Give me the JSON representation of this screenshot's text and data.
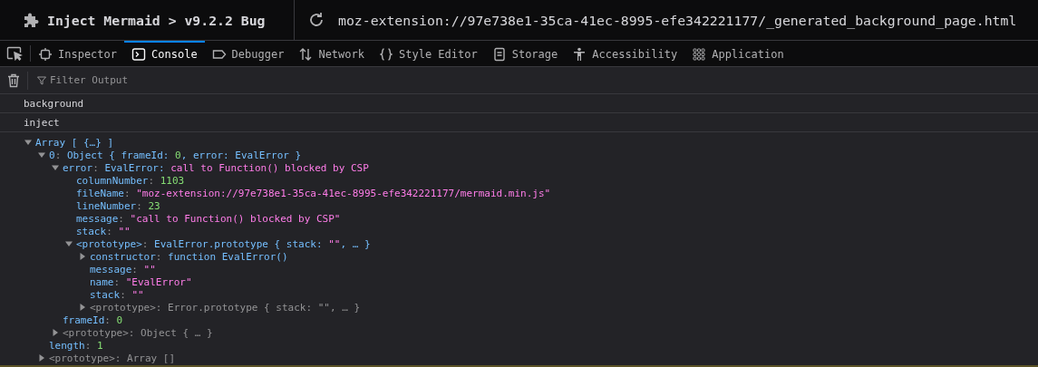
{
  "window": {
    "title": "Inject Mermaid > v9.2.2 Bug",
    "url": "moz-extension://97e738e1-35ca-41ec-8995-efe342221177/_generated_background_page.html"
  },
  "tabs": [
    {
      "label": "Inspector",
      "kind": "chip",
      "selected": false
    },
    {
      "label": "Console",
      "kind": "console",
      "selected": true
    },
    {
      "label": "Debugger",
      "kind": "tag",
      "selected": false
    },
    {
      "label": "Network",
      "kind": "arrows",
      "selected": false
    },
    {
      "label": "Style Editor",
      "kind": "braces",
      "selected": false
    },
    {
      "label": "Storage",
      "kind": "document",
      "selected": false
    },
    {
      "label": "Accessibility",
      "kind": "figure",
      "selected": false
    },
    {
      "label": "Application",
      "kind": "grid",
      "selected": false
    }
  ],
  "filter": {
    "placeholder": "Filter Output"
  },
  "messages": [
    "background",
    "inject"
  ],
  "tree": [
    {
      "expanded": true,
      "parts": [
        {
          "kind": "type",
          "text": "Array [ {…} ]"
        }
      ],
      "children": [
        {
          "expanded": true,
          "parts": [
            {
              "kind": "key",
              "text": "0"
            },
            {
              "kind": "punct",
              "text": ": "
            },
            {
              "kind": "type",
              "text": "Object { frameId: "
            },
            {
              "kind": "number",
              "text": "0"
            },
            {
              "kind": "type",
              "text": ", error: EvalError }"
            }
          ],
          "children": [
            {
              "expanded": true,
              "parts": [
                {
                  "kind": "key",
                  "text": "error"
                },
                {
                  "kind": "punct",
                  "text": ": "
                },
                {
                  "kind": "type",
                  "text": "EvalError: "
                },
                {
                  "kind": "string",
                  "text": "call to Function() blocked by CSP"
                }
              ],
              "children": [
                {
                  "parts": [
                    {
                      "kind": "key",
                      "text": "columnNumber"
                    },
                    {
                      "kind": "punct",
                      "text": ": "
                    },
                    {
                      "kind": "number",
                      "text": "1103"
                    }
                  ]
                },
                {
                  "parts": [
                    {
                      "kind": "key",
                      "text": "fileName"
                    },
                    {
                      "kind": "punct",
                      "text": ": "
                    },
                    {
                      "kind": "string",
                      "text": "\"moz-extension://97e738e1-35ca-41ec-8995-efe342221177/mermaid.min.js\""
                    }
                  ]
                },
                {
                  "parts": [
                    {
                      "kind": "key",
                      "text": "lineNumber"
                    },
                    {
                      "kind": "punct",
                      "text": ": "
                    },
                    {
                      "kind": "number",
                      "text": "23"
                    }
                  ]
                },
                {
                  "parts": [
                    {
                      "kind": "key",
                      "text": "message"
                    },
                    {
                      "kind": "punct",
                      "text": ": "
                    },
                    {
                      "kind": "string",
                      "text": "\"call to Function() blocked by CSP\""
                    }
                  ]
                },
                {
                  "parts": [
                    {
                      "kind": "key",
                      "text": "stack"
                    },
                    {
                      "kind": "punct",
                      "text": ": "
                    },
                    {
                      "kind": "string",
                      "text": "\"\""
                    }
                  ]
                },
                {
                  "expanded": true,
                  "parts": [
                    {
                      "kind": "key",
                      "text": "<prototype>"
                    },
                    {
                      "kind": "punct",
                      "text": ": "
                    },
                    {
                      "kind": "type",
                      "text": "EvalError.prototype { stack: "
                    },
                    {
                      "kind": "string",
                      "text": "\"\""
                    },
                    {
                      "kind": "type",
                      "text": ", … }"
                    }
                  ],
                  "children": [
                    {
                      "expanded": false,
                      "parts": [
                        {
                          "kind": "key",
                          "text": "constructor"
                        },
                        {
                          "kind": "punct",
                          "text": ": "
                        },
                        {
                          "kind": "type",
                          "text": "function EvalError()"
                        }
                      ]
                    },
                    {
                      "parts": [
                        {
                          "kind": "key",
                          "text": "message"
                        },
                        {
                          "kind": "punct",
                          "text": ": "
                        },
                        {
                          "kind": "string",
                          "text": "\"\""
                        }
                      ]
                    },
                    {
                      "parts": [
                        {
                          "kind": "key",
                          "text": "name"
                        },
                        {
                          "kind": "punct",
                          "text": ": "
                        },
                        {
                          "kind": "string",
                          "text": "\"EvalError\""
                        }
                      ]
                    },
                    {
                      "parts": [
                        {
                          "kind": "key",
                          "text": "stack"
                        },
                        {
                          "kind": "punct",
                          "text": ": "
                        },
                        {
                          "kind": "string",
                          "text": "\"\""
                        }
                      ]
                    },
                    {
                      "expanded": false,
                      "parts": [
                        {
                          "kind": "dim",
                          "text": "<prototype>: Error.prototype { stack: \"\", … }"
                        }
                      ]
                    }
                  ]
                }
              ]
            },
            {
              "parts": [
                {
                  "kind": "key",
                  "text": "frameId"
                },
                {
                  "kind": "punct",
                  "text": ": "
                },
                {
                  "kind": "number",
                  "text": "0"
                }
              ]
            },
            {
              "expanded": false,
              "parts": [
                {
                  "kind": "dim",
                  "text": "<prototype>: Object { … }"
                }
              ]
            }
          ]
        },
        {
          "parts": [
            {
              "kind": "key",
              "text": "length"
            },
            {
              "kind": "punct",
              "text": ": "
            },
            {
              "kind": "number",
              "text": "1"
            }
          ]
        },
        {
          "expanded": false,
          "parts": [
            {
              "kind": "dim",
              "text": "<prototype>: Array []"
            }
          ]
        }
      ]
    }
  ]
}
